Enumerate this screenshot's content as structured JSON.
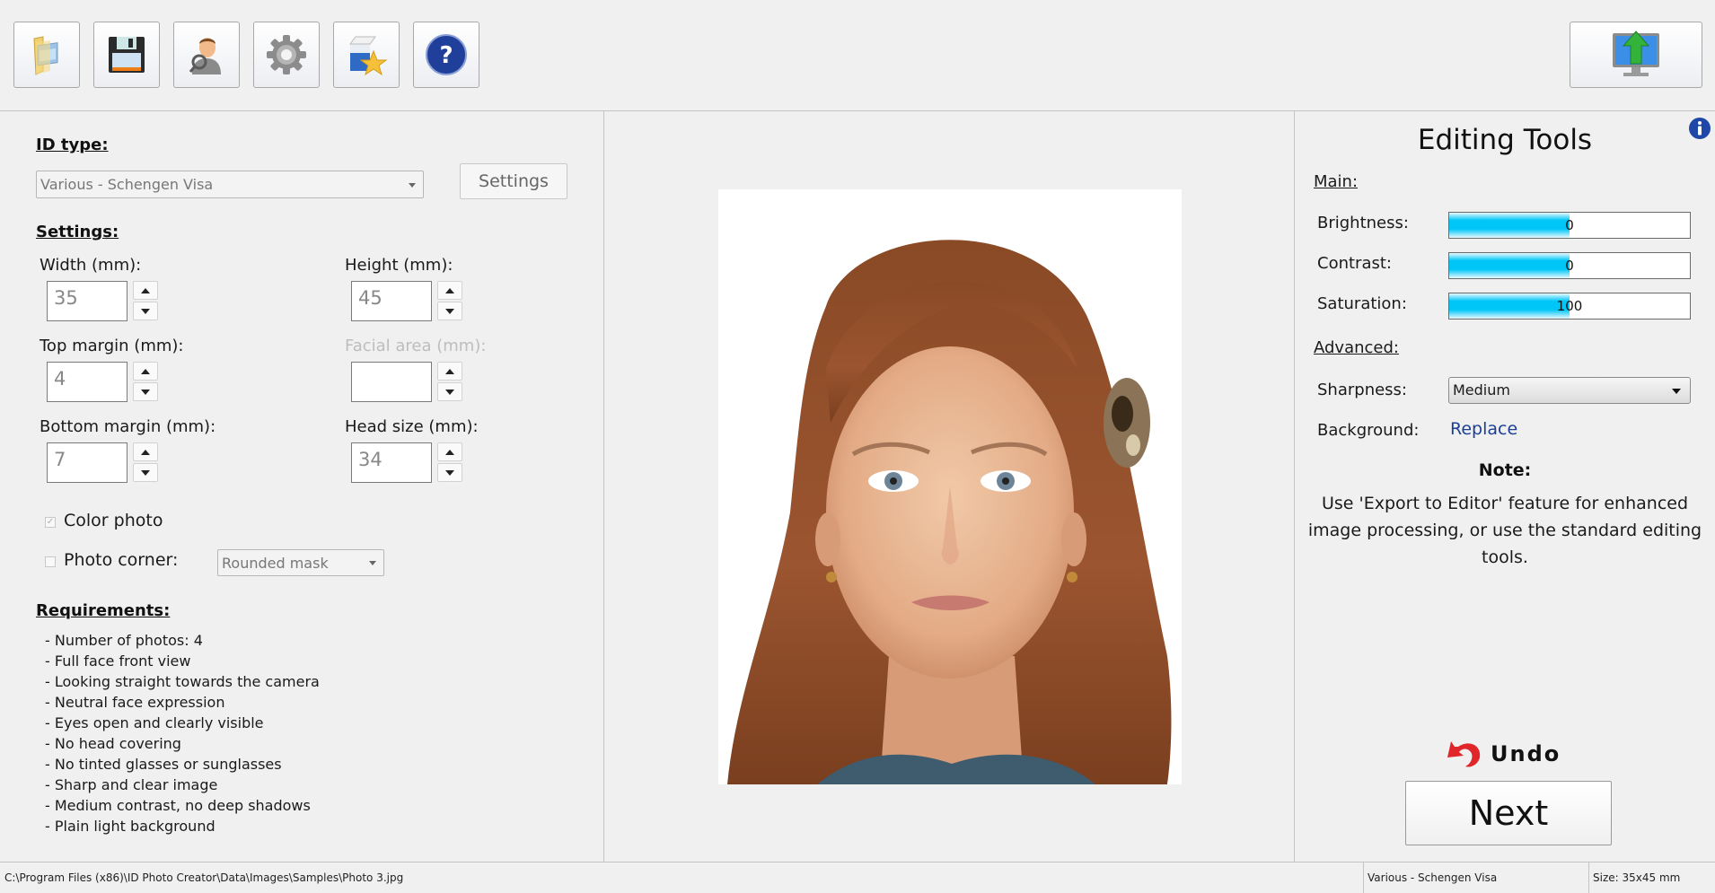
{
  "toolbar": {
    "buttons": [
      {
        "name": "open-folder",
        "icon": "folder-image-icon"
      },
      {
        "name": "save",
        "icon": "floppy-disk-icon"
      },
      {
        "name": "user",
        "icon": "user-search-icon"
      },
      {
        "name": "settings",
        "icon": "gear-icon"
      },
      {
        "name": "products",
        "icon": "box-star-icon"
      },
      {
        "name": "help",
        "icon": "help-icon"
      }
    ],
    "export_button": {
      "icon": "monitor-upload-icon"
    }
  },
  "left": {
    "id_type": {
      "title": "ID type:",
      "selected": "Various - Schengen Visa",
      "settings_button": "Settings"
    },
    "settings": {
      "title": "Settings:",
      "width": {
        "label": "Width (mm):",
        "value": "35"
      },
      "height": {
        "label": "Height (mm):",
        "value": "45"
      },
      "top_margin": {
        "label": "Top margin (mm):",
        "value": "4"
      },
      "facial_area": {
        "label": "Facial area (mm):",
        "value": ""
      },
      "bottom_margin": {
        "label": "Bottom margin (mm):",
        "value": "7"
      },
      "head_size": {
        "label": "Head size (mm):",
        "value": "34"
      },
      "color_photo": {
        "label": "Color photo",
        "checked": true
      },
      "photo_corner": {
        "label": "Photo corner:",
        "checked": false,
        "selected": "Rounded mask"
      }
    },
    "requirements": {
      "title": "Requirements:",
      "items": [
        "- Number of photos: 4",
        "- Full face front view",
        "- Looking straight towards the camera",
        "- Neutral face expression",
        "- Eyes open and clearly visible",
        "- No head covering",
        "- No tinted glasses or sunglasses",
        "- Sharp and clear image",
        "- Medium contrast, no deep shadows",
        "- Plain light background"
      ]
    }
  },
  "right": {
    "title": "Editing Tools",
    "main_label": "Main:",
    "brightness": {
      "label": "Brightness:",
      "value": "0",
      "fill_fraction": 0.5
    },
    "contrast": {
      "label": "Contrast:",
      "value": "0",
      "fill_fraction": 0.5
    },
    "saturation": {
      "label": "Saturation:",
      "value": "100",
      "fill_fraction": 0.5
    },
    "advanced_label": "Advanced:",
    "sharpness": {
      "label": "Sharpness:",
      "selected": "Medium"
    },
    "background": {
      "label": "Background:",
      "link": "Replace"
    },
    "note_title": "Note:",
    "note_body": "Use 'Export to Editor' feature for enhanced image processing, or use the standard editing tools.",
    "undo_label": "Undo",
    "next_label": "Next"
  },
  "status_bar": {
    "path": "C:\\Program Files (x86)\\ID Photo Creator\\Data\\Images\\Samples\\Photo 3.jpg",
    "id_type": "Various - Schengen Visa",
    "size": "Size: 35x45 mm"
  },
  "colors": {
    "bar_fill": "#00c6f7",
    "link": "#1c3f94",
    "undo_arrow": "#e0262b"
  }
}
